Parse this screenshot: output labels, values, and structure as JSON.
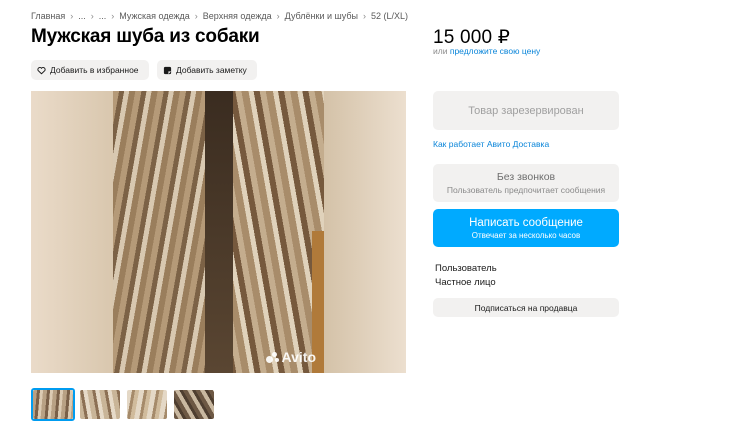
{
  "breadcrumb": {
    "items": [
      "Главная",
      "...",
      "...",
      "Мужская одежда",
      "Верхняя одежда",
      "Дублёнки и шубы",
      "52 (L/XL)"
    ],
    "separator": "›"
  },
  "listing": {
    "title": "Мужская шуба из собаки",
    "price": "15 000 ₽",
    "price_or": "или",
    "price_offer_link": "предложите свою цену"
  },
  "actions": {
    "favorite_label": "Добавить в избранное",
    "note_label": "Добавить заметку"
  },
  "gallery": {
    "watermark": "Avito",
    "thumbnail_count": 4,
    "active_thumbnail": 1
  },
  "sidebar": {
    "reserved_label": "Товар зарезервирован",
    "delivery_link": "Как работает Авито Доставка",
    "no_calls_label": "Без звонков",
    "no_calls_sub": "Пользователь предпочитает сообщения",
    "message_label": "Написать сообщение",
    "message_sub": "Отвечает за несколько часов",
    "seller_name": "Пользователь",
    "seller_type": "Частное лицо",
    "subscribe_label": "Подписаться на продавца"
  },
  "colors": {
    "accent": "#00aaff",
    "link": "#0a85d9",
    "button_bg": "#f2f1f0",
    "active_thumb_border": "#009cf0"
  },
  "icons": {
    "favorite": "heart-icon",
    "note": "note-icon"
  }
}
